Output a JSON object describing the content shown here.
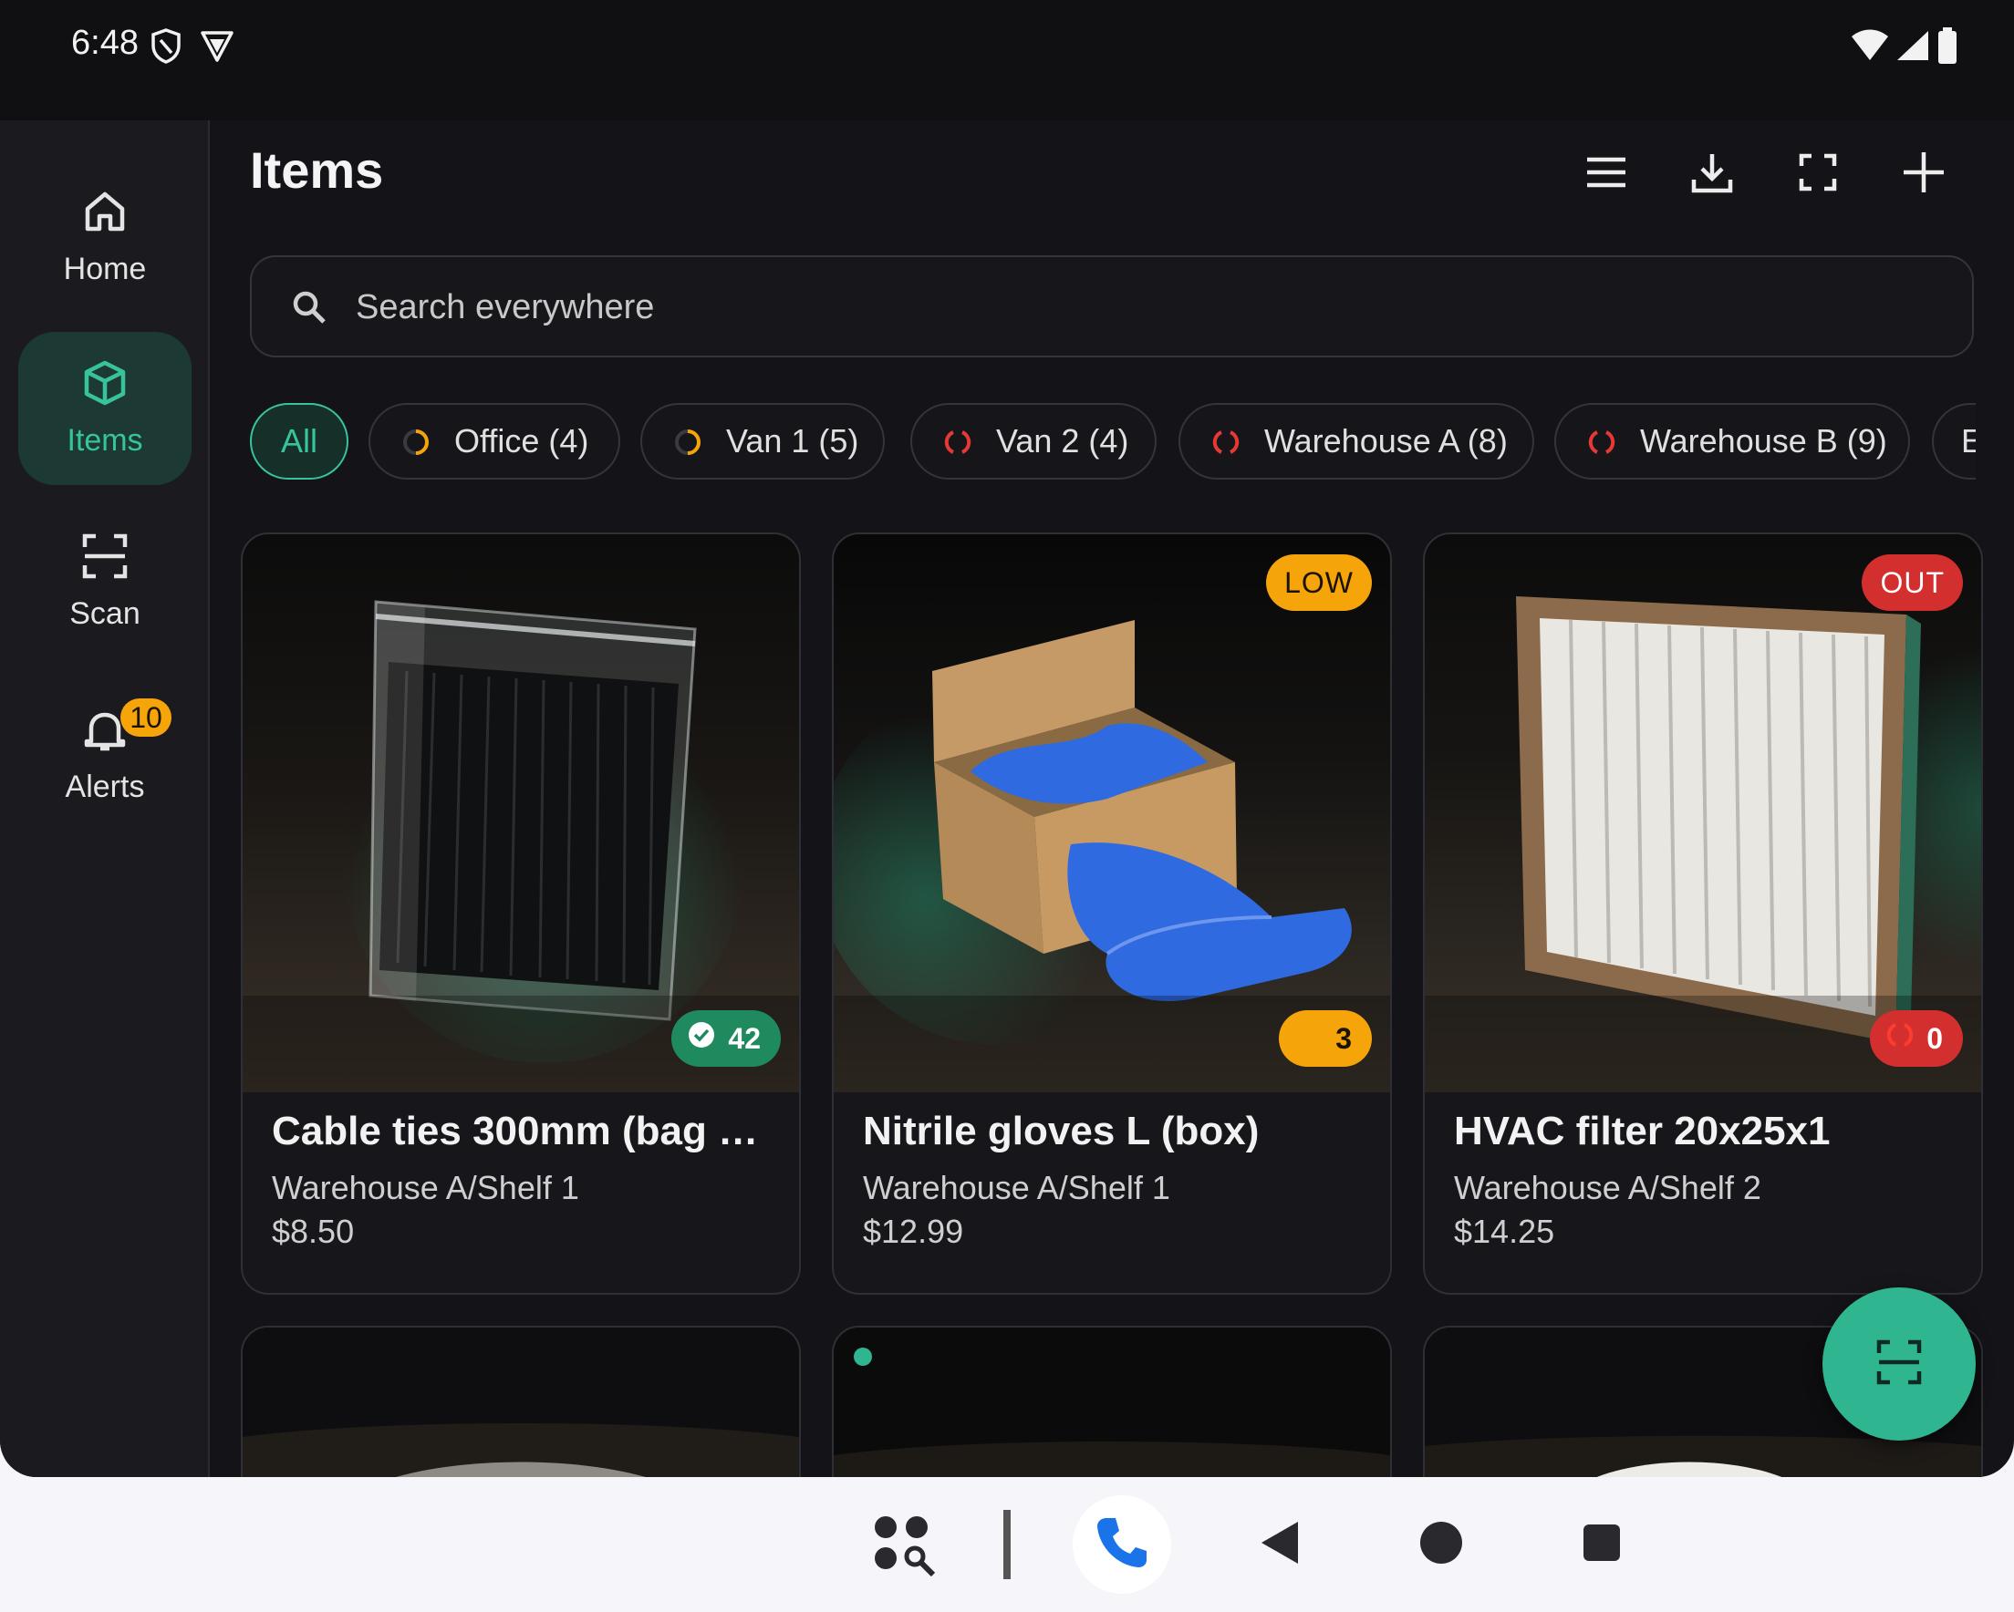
{
  "status_bar": {
    "time": "6:48"
  },
  "nav_rail": {
    "items": [
      {
        "label": "Home"
      },
      {
        "label": "Items"
      },
      {
        "label": "Scan"
      },
      {
        "label": "Alerts",
        "badge": "10"
      }
    ]
  },
  "header": {
    "title": "Items"
  },
  "search": {
    "placeholder": "Search everywhere"
  },
  "filter_chips": [
    {
      "label": "All"
    },
    {
      "label": "Office (4)"
    },
    {
      "label": "Van 1 (5)"
    },
    {
      "label": "Van 2 (4)"
    },
    {
      "label": "Warehouse A (8)"
    },
    {
      "label": "Warehouse B (9)"
    },
    {
      "label": "E"
    }
  ],
  "items": [
    {
      "name": "Cable ties 300mm (bag o…",
      "location": "Warehouse A/Shelf 1",
      "price": "$8.50",
      "quantity": "42"
    },
    {
      "name": "Nitrile gloves L (box)",
      "location": "Warehouse A/Shelf 1",
      "price": "$12.99",
      "quantity": "3",
      "status": "LOW"
    },
    {
      "name": "HVAC filter 20x25x1",
      "location": "Warehouse A/Shelf 2",
      "price": "$14.25",
      "quantity": "0",
      "status": "OUT"
    }
  ],
  "colors": {
    "accent": "#37c49d",
    "low": "#f5a40a",
    "out": "#d32f2f",
    "ok": "#1f8a5e",
    "background": "#141418"
  }
}
